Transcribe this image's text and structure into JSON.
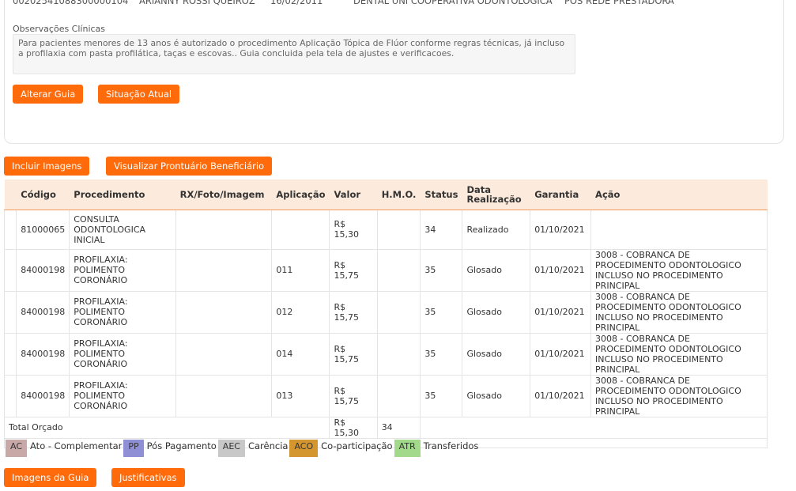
{
  "header": {
    "carteira": "00202541088300000104",
    "beneficiario": "ARIANNY ROSSI QUEIROZ",
    "nascimento": "16/02/2011",
    "plano": "DENTAL UNI COOPERATIVA ODONTOLOGICA",
    "rede": "POS REDE PRESTADORA"
  },
  "obs": {
    "label": "Observações Clínicas",
    "text": "Para pacientes menores de 13 anos é autorizado o procedimento Aplicação Tópica de Flúor conforme regras técnicas, já incluso a profilaxia com pasta profilática, taças e escovas.. Guia concluida pela tela de ajustes e verificacoes."
  },
  "buttons": {
    "alterar": "Alterar Guia",
    "situacao": "Situação Atual",
    "incluir_imagens": "Incluir Imagens",
    "visualizar": "Visualizar Prontuário Beneficiário",
    "imagens_guia": "Imagens da Guia",
    "justificativas": "Justificativas"
  },
  "table": {
    "headers": [
      "Código",
      "Procedimento",
      "RX/Foto/Imagem",
      "Aplicação",
      "Valor",
      "H.M.O.",
      "Status",
      "Data Realização",
      "Garantia",
      "Ação"
    ],
    "rows": [
      {
        "codigo": "81000065",
        "procedimento": "CONSULTA ODONTOLOGICA INICIAL",
        "rx": "",
        "aplicacao": "",
        "valor": "R$ 15,30",
        "hmo": "",
        "status": "34",
        "data": "Realizado",
        "garantia": "01/10/2021",
        "acao": ""
      },
      {
        "codigo": "84000198",
        "procedimento": "PROFILAXIA: POLIMENTO CORONÁRIO",
        "rx": "",
        "aplicacao": "011",
        "valor": "R$ 15,75",
        "hmo": "",
        "status": "35",
        "data": "Glosado",
        "garantia": "01/10/2021",
        "acao": "3008 - COBRANCA DE PROCEDIMENTO ODONTOLOGICO INCLUSO NO PROCEDIMENTO PRINCIPAL"
      },
      {
        "codigo": "84000198",
        "procedimento": "PROFILAXIA: POLIMENTO CORONÁRIO",
        "rx": "",
        "aplicacao": "012",
        "valor": "R$ 15,75",
        "hmo": "",
        "status": "35",
        "data": "Glosado",
        "garantia": "01/10/2021",
        "acao": "3008 - COBRANCA DE PROCEDIMENTO ODONTOLOGICO INCLUSO NO PROCEDIMENTO PRINCIPAL"
      },
      {
        "codigo": "84000198",
        "procedimento": "PROFILAXIA: POLIMENTO CORONÁRIO",
        "rx": "",
        "aplicacao": "014",
        "valor": "R$ 15,75",
        "hmo": "",
        "status": "35",
        "data": "Glosado",
        "garantia": "01/10/2021",
        "acao": "3008 - COBRANCA DE PROCEDIMENTO ODONTOLOGICO INCLUSO NO PROCEDIMENTO PRINCIPAL"
      },
      {
        "codigo": "84000198",
        "procedimento": "PROFILAXIA: POLIMENTO CORONÁRIO",
        "rx": "",
        "aplicacao": "013",
        "valor": "R$ 15,75",
        "hmo": "",
        "status": "35",
        "data": "Glosado",
        "garantia": "01/10/2021",
        "acao": "3008 - COBRANCA DE PROCEDIMENTO ODONTOLOGICO INCLUSO NO PROCEDIMENTO PRINCIPAL"
      }
    ],
    "total_label": "Total Orçado",
    "total_valor": "R$ 15,30",
    "total_hmo": "34"
  },
  "legend": [
    {
      "code": "AC",
      "label": "Ato - Complementar",
      "color": "#c9a8a8"
    },
    {
      "code": "PP",
      "label": "Pós Pagamento",
      "color": "#8f8fd6"
    },
    {
      "code": "AEC",
      "label": "Carência",
      "color": "#c8c8c8"
    },
    {
      "code": "ACO",
      "label": "Co-participação",
      "color": "#d4962e"
    },
    {
      "code": "ATR",
      "label": "Transferidos",
      "color": "#a3d98a"
    }
  ],
  "colors": {
    "accent": "#ff6a0a",
    "header_bg": "#fcebdc",
    "header_border": "#f29a5c"
  }
}
